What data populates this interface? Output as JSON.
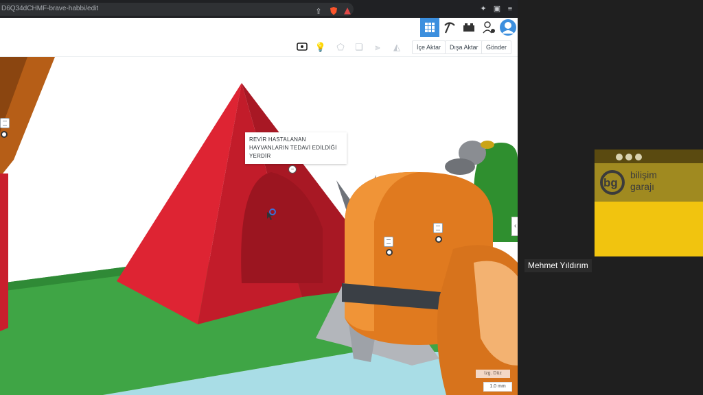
{
  "browser": {
    "url": "D6Q34dCHMF-brave-habbi/edit",
    "shield_badge": "0",
    "alert_badge": "3"
  },
  "toolbar": {
    "import_label": "İçe Aktar",
    "export_label": "Dışa Aktar",
    "send_label": "Gönder"
  },
  "scene": {
    "tooltip_text": "REVİR HASTALANAN HAYVANLARIN TEDAVİ EDİLDİĞİ YERDİR",
    "snap_label": "Izg. Düz",
    "snap_value": "1.0 mm"
  },
  "video": {
    "brand_line1": "bilişim",
    "brand_line2": "garajı",
    "participant_name": "Mehmet Yıldırım"
  },
  "colors": {
    "accent": "#3c8fde",
    "red_shape": "#d8202f",
    "orange_shape": "#e07a1f",
    "ground": "#3fa545",
    "panel": "#1f1f1f",
    "video_bg": "#f1c40f"
  }
}
